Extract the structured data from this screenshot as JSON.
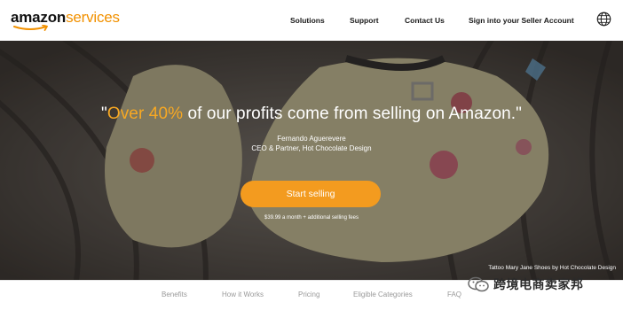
{
  "header": {
    "logo": {
      "brand": "amazon",
      "product": "services"
    },
    "nav": {
      "solutions": "Solutions",
      "support": "Support",
      "contact": "Contact Us",
      "signin": "Sign into your Seller Account"
    },
    "globe_icon": "globe-icon"
  },
  "hero": {
    "quote_open": "\"",
    "quote_highlight": "Over 40%",
    "quote_rest": " of our profits come from selling on Amazon.\"",
    "author_name": "Fernando Aguerevere",
    "author_title": "CEO & Partner, Hot Chocolate Design",
    "cta_label": "Start selling",
    "fees_note": "$39.99 a month + additional selling fees",
    "image_caption": "Tattoo Mary Jane Shoes by Hot Chocolate Design"
  },
  "tabs": {
    "benefits": "Benefits",
    "how": "How it Works",
    "pricing": "Pricing",
    "eligible": "Eligible Categories",
    "faq": "FAQ"
  },
  "watermark": {
    "text": "跨境电商卖家邦"
  },
  "colors": {
    "accent_orange": "#f39b1f",
    "highlight_orange": "#f7a823",
    "tab_gray": "#9a9a9a"
  }
}
